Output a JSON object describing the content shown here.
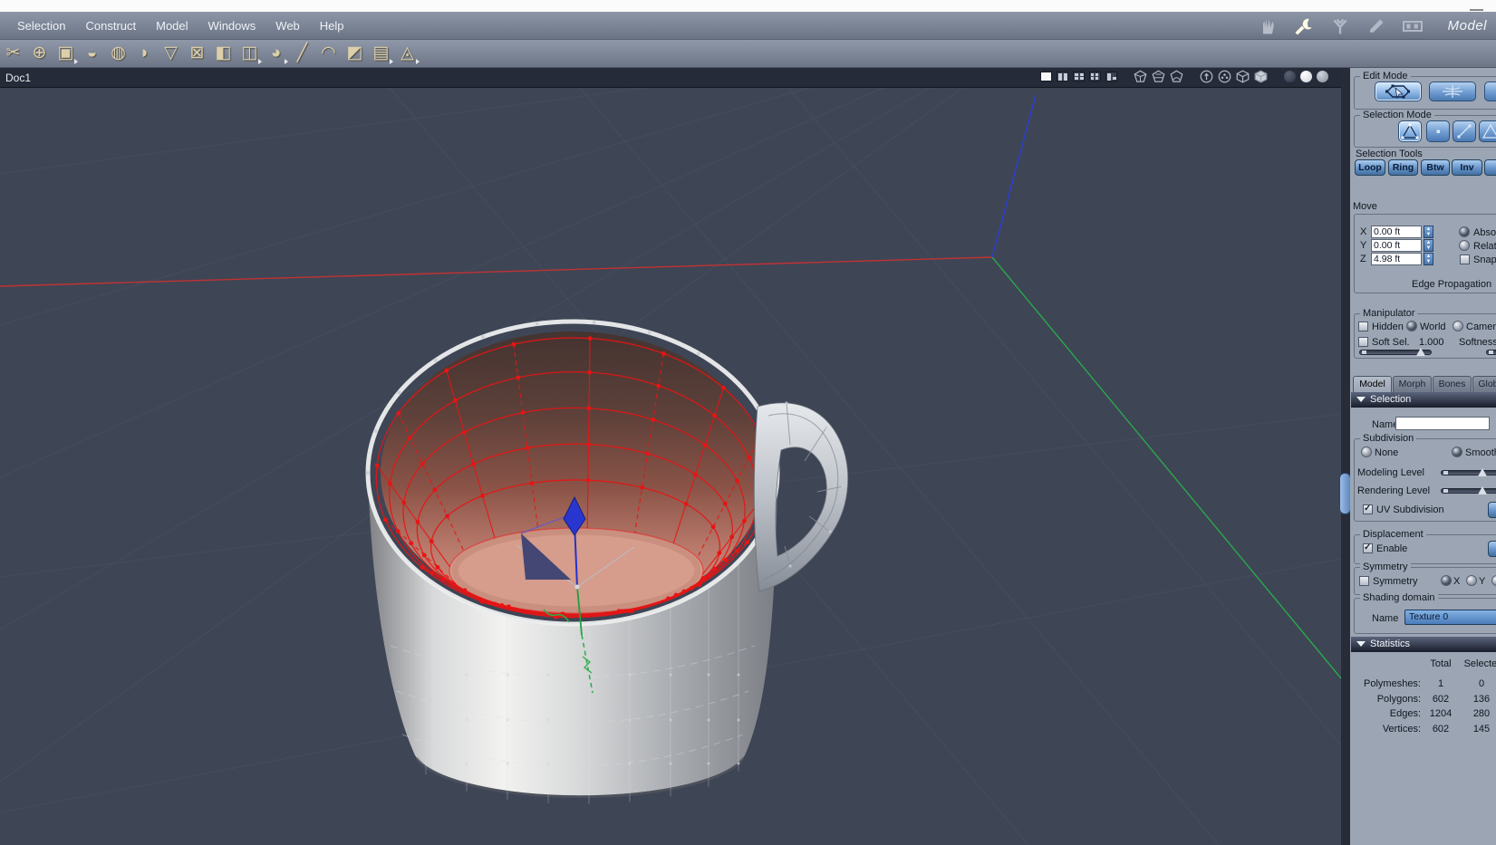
{
  "window": {
    "minimize_icon": "minimize"
  },
  "menubar": {
    "menus": [
      "Selection",
      "Construct",
      "Model",
      "Windows",
      "Web",
      "Help"
    ],
    "workspace_icons": [
      "hand",
      "wrench",
      "fork",
      "brush",
      "film"
    ],
    "active_workspace_icon": "wrench",
    "mode_label": "Model"
  },
  "toolbar": {
    "tools": [
      {
        "name": "cut-scissors",
        "glyph": "✂",
        "dropdown": false
      },
      {
        "name": "weld",
        "glyph": "⊕",
        "dropdown": false
      },
      {
        "name": "tessellate",
        "glyph": "▣",
        "dropdown": true
      },
      {
        "name": "dome",
        "glyph": "◒",
        "dropdown": false
      },
      {
        "name": "lathe",
        "glyph": "◍",
        "dropdown": false
      },
      {
        "name": "curve-extract",
        "glyph": "◗",
        "dropdown": false
      },
      {
        "name": "goblet-sweep",
        "glyph": "▽",
        "dropdown": false
      },
      {
        "name": "dissolve",
        "glyph": "⊠",
        "dropdown": false
      },
      {
        "name": "cube-primitive",
        "glyph": "◧",
        "dropdown": false
      },
      {
        "name": "box-open",
        "glyph": "◫",
        "dropdown": true
      },
      {
        "name": "sphere-primitive",
        "glyph": "◕",
        "dropdown": true
      },
      {
        "name": "line-tool",
        "glyph": "╱",
        "dropdown": false
      },
      {
        "name": "bend",
        "glyph": "◠",
        "dropdown": false
      },
      {
        "name": "fold",
        "glyph": "◩",
        "dropdown": false
      },
      {
        "name": "stack-taper",
        "glyph": "▤",
        "dropdown": true
      },
      {
        "name": "deform-pinch",
        "glyph": "◬",
        "dropdown": true
      }
    ]
  },
  "document": {
    "tab_label": "Doc1",
    "view_icons": [
      "layout-single",
      "layout-split",
      "layout-quad",
      "layout-grid",
      "layout-corner",
      "shade-wire-1",
      "shade-wire-2",
      "shade-flat",
      "orbit-arrow",
      "orbit-dots",
      "wire-cube",
      "solid-cube",
      "sphere-dark",
      "sphere-bright",
      "sphere-gray"
    ]
  },
  "panel": {
    "edit_mode": {
      "title": "Edit Mode",
      "buttons": [
        "polygon-edit",
        "object-axes",
        "uv-sphere"
      ],
      "selected": "polygon-edit"
    },
    "selection_mode": {
      "title": "Selection Mode",
      "buttons": [
        "auto-select",
        "points",
        "edges",
        "faces"
      ],
      "selected": "auto-select"
    },
    "selection_tools": {
      "title": "Selection Tools",
      "buttons": [
        "Loop",
        "Ring",
        "Btw",
        "Inv"
      ]
    },
    "move": {
      "title": "Move",
      "fields": [
        {
          "axis": "X",
          "value": "0.00 ft"
        },
        {
          "axis": "Y",
          "value": "0.00 ft"
        },
        {
          "axis": "Z",
          "value": "4.98 ft"
        }
      ],
      "absolute_label": "Absolute",
      "relative_label": "Relative",
      "snap_label": "Snap",
      "selected_option": "Absolute",
      "edge_propagation_label": "Edge Propagation"
    },
    "manipulator": {
      "title": "Manipulator",
      "hidden_label": "Hidden",
      "world_label": "World",
      "camera_label": "Camera",
      "selected_space": "World",
      "soft_sel_label": "Soft Sel.",
      "soft_sel_value": "1.000",
      "softness_label": "Softness"
    },
    "tabs": [
      "Model",
      "Morph",
      "Bones",
      "Global"
    ],
    "active_tab": "Model",
    "selection_section": {
      "title": "Selection",
      "name_label": "Name",
      "name_value": ""
    },
    "subdivision": {
      "title": "Subdivision",
      "none_label": "None",
      "smooth_label": "Smooth",
      "selected": "Smooth",
      "modeling_level_label": "Modeling Level",
      "rendering_level_label": "Rendering Level",
      "uv_subdivision_label": "UV Subdivision",
      "uv_subdivision_checked": true
    },
    "displacement": {
      "title": "Displacement",
      "enable_label": "Enable",
      "enable_checked": true
    },
    "symmetry": {
      "title": "Symmetry",
      "checkbox_label": "Symmetry",
      "axes": [
        "X",
        "Y"
      ],
      "selected_axis": "X"
    },
    "shading_domain": {
      "title": "Shading domain",
      "name_label": "Name",
      "value": "Texture 0"
    },
    "statistics": {
      "title": "Statistics",
      "columns": [
        "Total",
        "Selected"
      ],
      "rows": [
        {
          "label": "Polymeshes:",
          "total": "1",
          "selected": "0"
        },
        {
          "label": "Polygons:",
          "total": "602",
          "selected": "136"
        },
        {
          "label": "Edges:",
          "total": "1204",
          "selected": "280"
        },
        {
          "label": "Vertices:",
          "total": "602",
          "selected": "145"
        }
      ]
    }
  },
  "colors": {
    "viewport_bg": "#3e4555",
    "grid_line": "#4b5368",
    "axis_x_red": "#c23232",
    "axis_y_green": "#2aa84a",
    "axis_z_blue": "#2a3fd4",
    "selection_wire_red": "#e81414",
    "panel_bg": "#9ba5b3",
    "button_blue": "#6f9bd0"
  }
}
